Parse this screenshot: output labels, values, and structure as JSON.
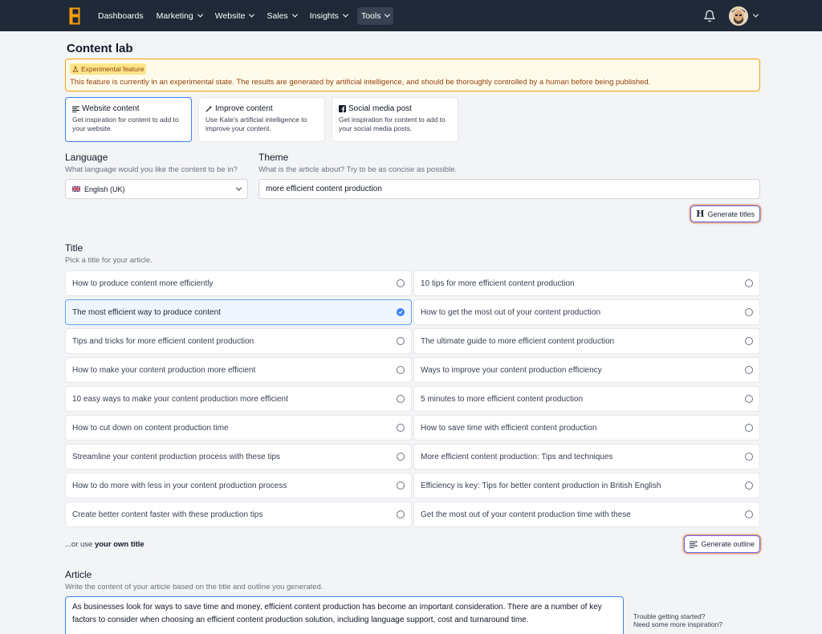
{
  "nav": {
    "items": [
      {
        "label": "Dashboards",
        "caret": false
      },
      {
        "label": "Marketing",
        "caret": true
      },
      {
        "label": "Website",
        "caret": true
      },
      {
        "label": "Sales",
        "caret": true
      },
      {
        "label": "Insights",
        "caret": true
      },
      {
        "label": "Tools",
        "caret": true,
        "active": true
      }
    ]
  },
  "page": {
    "title": "Content lab"
  },
  "alert": {
    "badge": "Experimental feature",
    "text": "This feature is currently in an experimental state. The results are generated by artificial intelligence, and should be thoroughly controlled by a human before being published."
  },
  "cards": [
    {
      "title": "Website content",
      "desc": "Get inspiration for content to add to your website.",
      "icon": "lines-icon",
      "selected": true
    },
    {
      "title": "Improve content",
      "desc": "Use Kate's artificial intelligence to improve your content.",
      "icon": "wand-icon",
      "selected": false
    },
    {
      "title": "Social media post",
      "desc": "Get inspiration for content to add to your social media posts.",
      "icon": "facebook-icon",
      "selected": false
    }
  ],
  "language": {
    "label": "Language",
    "hint": "What language would you like the content to be in?",
    "value": "English (UK)"
  },
  "theme": {
    "label": "Theme",
    "hint": "What is the article about? Try to be as concise as possible.",
    "value": "more efficient content production"
  },
  "buttons": {
    "generate_titles": "Generate titles",
    "generate_outline": "Generate outline"
  },
  "title_section": {
    "label": "Title",
    "hint": "Pick a title for your article.",
    "options": [
      "How to produce content more efficiently",
      "10 tips for more efficient content production",
      "The most efficient way to produce content",
      "How to get the most out of your content production",
      "Tips and tricks for more efficient content production",
      "The ultimate guide to more efficient content production",
      "How to make your content production more efficient",
      "Ways to improve your content production efficiency",
      "10 easy ways to make your content production more efficient",
      "5 minutes to more efficient content production",
      "How to cut down on content production time",
      "How to save time with efficient content production",
      "Streamline your content production process with these tips",
      "More efficient content production: Tips and techniques",
      "How to do more with less in your content production process",
      "Efficiency is key: Tips for better content production in British English",
      "Create better content faster with these production tips",
      "Get the most out of your content production time with these"
    ],
    "selected_index": 2,
    "own_prefix": "...or use ",
    "own_bold": "your own title"
  },
  "article": {
    "label": "Article",
    "hint": "Write the content of your article based on the title and outline you generated.",
    "text": "As businesses look for ways to save time and money, efficient content production has become an important consideration. There are a number of key factors to consider when choosing an efficient content production solution, including language support, cost and turnaround time.",
    "help_line1": "Trouble getting started?",
    "help_line2": "Need some more inspiration?"
  },
  "colors": {
    "nav_bg": "#1f2937",
    "accent": "#3b82f6",
    "alert_border": "#f59e0b"
  }
}
